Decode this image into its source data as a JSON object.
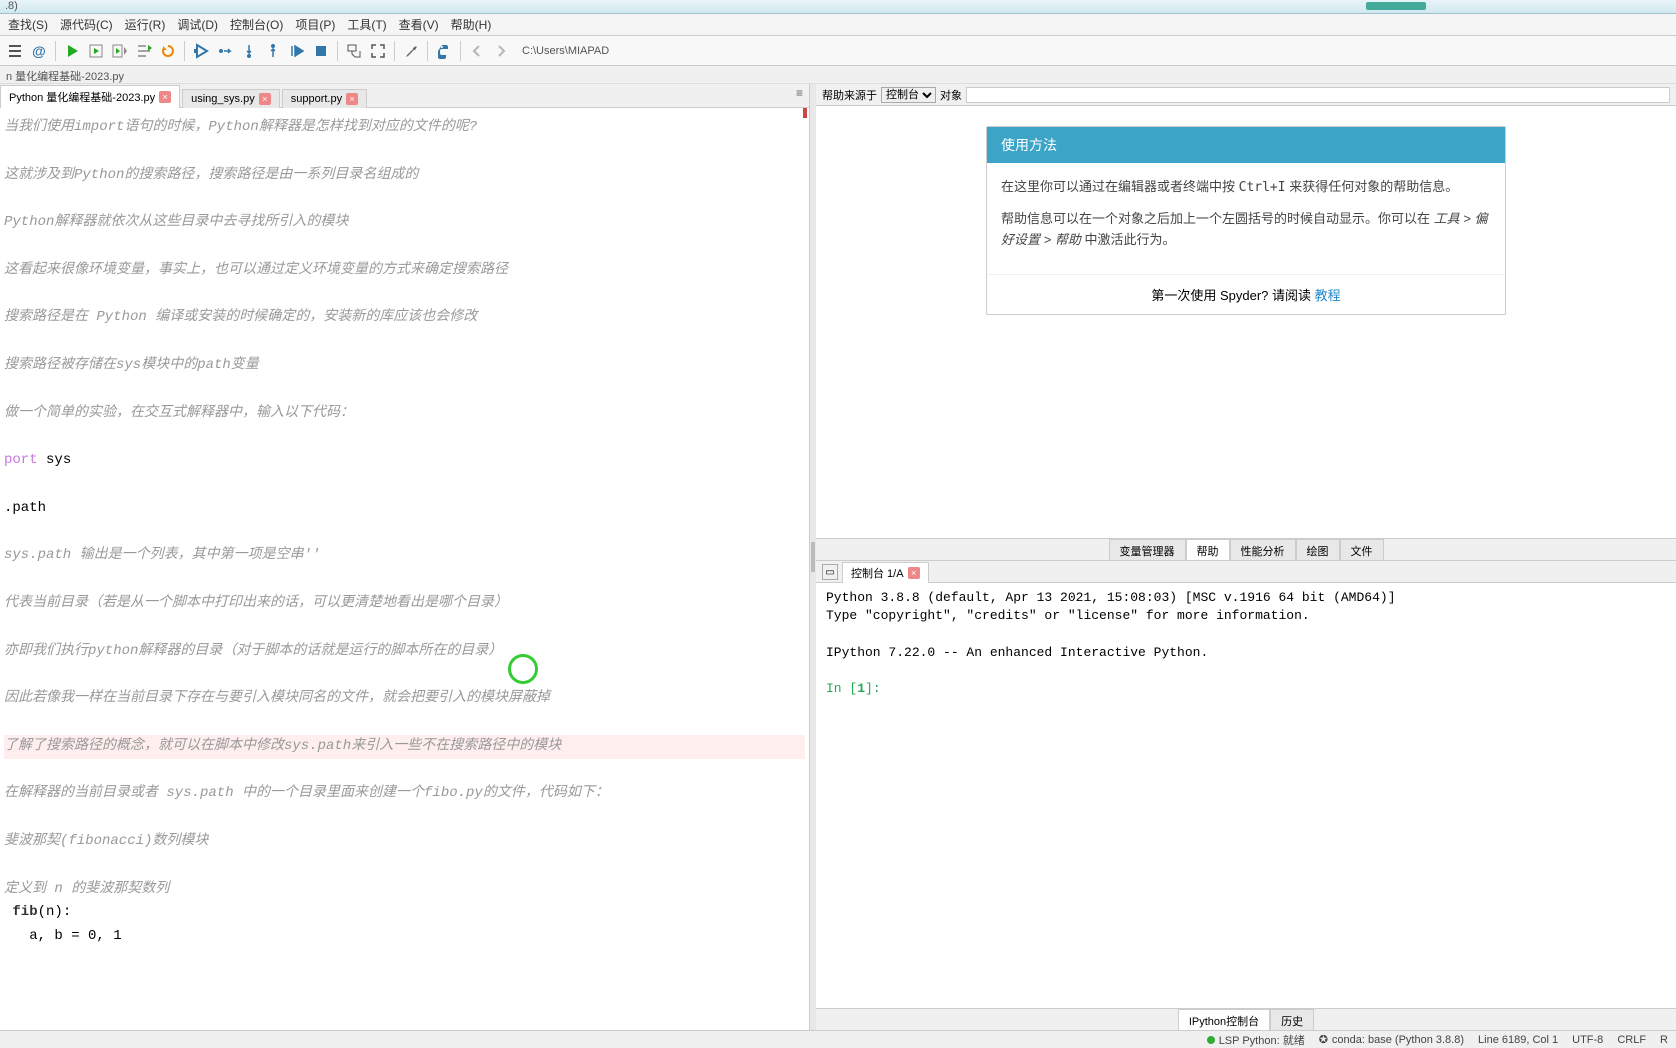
{
  "titlebar": {
    "version_hint": ".8)"
  },
  "menubar": {
    "items": [
      "查找(S)",
      "源代码(C)",
      "运行(R)",
      "调试(D)",
      "控制台(O)",
      "项目(P)",
      "工具(T)",
      "查看(V)",
      "帮助(H)"
    ]
  },
  "toolbar": {
    "path": "C:\\Users\\MIAPAD"
  },
  "breadcrumb": {
    "text": "n 量化编程基础-2023.py"
  },
  "editor": {
    "tabs": [
      {
        "label": "Python 量化编程基础-2023.py",
        "active": true,
        "dirty": true
      },
      {
        "label": "using_sys.py",
        "active": false,
        "dirty": true
      },
      {
        "label": "support.py",
        "active": false,
        "dirty": true
      }
    ],
    "lines": [
      {
        "t": "comment",
        "text": "当我们使用import语句的时候，Python解释器是怎样找到对应的文件的呢?"
      },
      {
        "t": "blank",
        "text": ""
      },
      {
        "t": "comment",
        "text": "这就涉及到Python的搜索路径，搜索路径是由一系列目录名组成的"
      },
      {
        "t": "blank",
        "text": ""
      },
      {
        "t": "comment",
        "text": "Python解释器就依次从这些目录中去寻找所引入的模块"
      },
      {
        "t": "blank",
        "text": ""
      },
      {
        "t": "comment",
        "text": "这看起来很像环境变量，事实上，也可以通过定义环境变量的方式来确定搜索路径"
      },
      {
        "t": "blank",
        "text": ""
      },
      {
        "t": "comment",
        "text": "搜索路径是在 Python 编译或安装的时候确定的，安装新的库应该也会修改"
      },
      {
        "t": "blank",
        "text": ""
      },
      {
        "t": "comment",
        "text": "搜索路径被存储在sys模块中的path变量"
      },
      {
        "t": "blank",
        "text": ""
      },
      {
        "t": "comment",
        "text": "做一个简单的实验，在交互式解释器中，输入以下代码："
      },
      {
        "t": "blank",
        "text": ""
      },
      {
        "t": "code",
        "text": "port sys",
        "kw": "port"
      },
      {
        "t": "blank",
        "text": ""
      },
      {
        "t": "plain",
        "text": ".path"
      },
      {
        "t": "blank",
        "text": ""
      },
      {
        "t": "comment",
        "text": "sys.path 输出是一个列表，其中第一项是空串''"
      },
      {
        "t": "blank",
        "text": ""
      },
      {
        "t": "comment",
        "text": "代表当前目录（若是从一个脚本中打印出来的话，可以更清楚地看出是哪个目录）"
      },
      {
        "t": "blank",
        "text": ""
      },
      {
        "t": "comment",
        "text": "亦即我们执行python解释器的目录（对于脚本的话就是运行的脚本所在的目录）"
      },
      {
        "t": "blank",
        "text": ""
      },
      {
        "t": "comment",
        "text": "因此若像我一样在当前目录下存在与要引入模块同名的文件，就会把要引入的模块屏蔽掉"
      },
      {
        "t": "blank",
        "text": ""
      },
      {
        "t": "comment-hl",
        "text": "了解了搜索路径的概念，就可以在脚本中修改sys.path来引入一些不在搜索路径中的模块"
      },
      {
        "t": "blank",
        "text": ""
      },
      {
        "t": "comment",
        "text": "在解释器的当前目录或者 sys.path 中的一个目录里面来创建一个fibo.py的文件，代码如下："
      },
      {
        "t": "blank",
        "text": ""
      },
      {
        "t": "comment",
        "text": "斐波那契(fibonacci)数列模块"
      },
      {
        "t": "blank",
        "text": ""
      },
      {
        "t": "comment",
        "text": "定义到 n 的斐波那契数列"
      },
      {
        "t": "def",
        "text": " fib(n):"
      },
      {
        "t": "plain",
        "text": "   a, b = 0, 1"
      }
    ]
  },
  "help_source": {
    "label": "帮助来源于",
    "selected": "控制台",
    "object_label": "对象"
  },
  "help_card": {
    "title": "使用方法",
    "p1_a": "在这里你可以通过在编辑器或者终端中按 ",
    "p1_kbd": "Ctrl+I",
    "p1_b": " 来获得任何对象的帮助信息。",
    "p2_a": "帮助信息可以在一个对象之后加上一个左圆括号的时候自动显示。你可以在 ",
    "p2_i": "工具 > 偏好设置 > 帮助",
    "p2_b": " 中激活此行为。",
    "footer_text": "第一次使用 Spyder? 请阅读 ",
    "footer_link": "教程"
  },
  "right_tabs": {
    "items": [
      "变量管理器",
      "帮助",
      "性能分析",
      "绘图",
      "文件"
    ]
  },
  "console": {
    "tab_label": "控制台 1/A",
    "banner_1": "Python 3.8.8 (default, Apr 13 2021, 15:08:03) [MSC v.1916 64 bit (AMD64)]",
    "banner_2": "Type \"copyright\", \"credits\" or \"license\" for more information.",
    "banner_3": "IPython 7.22.0 -- An enhanced Interactive Python.",
    "prompt_in": "In [",
    "prompt_num": "1",
    "prompt_close": "]:"
  },
  "console_bottom_tabs": {
    "items": [
      "IPython控制台",
      "历史"
    ]
  },
  "statusbar": {
    "lsp": "LSP Python: 就绪",
    "conda": "conda: base (Python 3.8.8)",
    "line": "Line 6189, Col 1",
    "encoding": "UTF-8",
    "eol": "CRLF",
    "mode": "R"
  }
}
